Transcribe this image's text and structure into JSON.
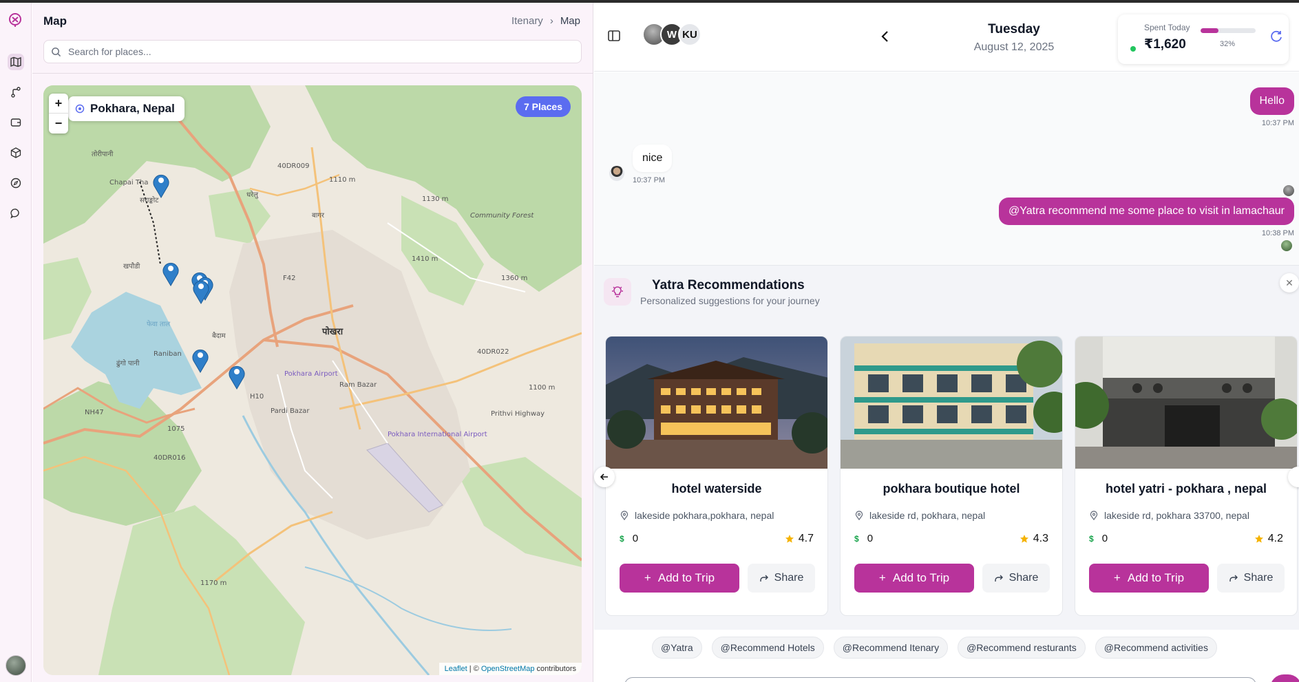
{
  "map_panel": {
    "title": "Map",
    "breadcrumb": [
      "Itenary",
      "Map"
    ],
    "search_placeholder": "Search for places...",
    "location_label": "Pokhara, Nepal",
    "places_badge": "7 Places",
    "zoom_in": "+",
    "zoom_out": "−",
    "attribution": {
      "leaflet": "Leaflet",
      "sep": " | © ",
      "osm": "OpenStreetMap",
      "suffix": " contributors"
    },
    "map_labels": [
      "तोरीपानी",
      "Chapai Tha",
      "सराङ्कोट",
      "खपौडी",
      "फेवा ताल",
      "Raniban",
      "ढुंगो पानी",
      "बैदाम",
      "पोखरा",
      "40DR009",
      "40DR022",
      "40DR016",
      "NH47",
      "H10",
      "F42",
      "बागर",
      "धरेलु",
      "Community Forest",
      "Pokhara Airport",
      "Pokhara International Airport",
      "Ram Bazar",
      "Pardi Bazar",
      "Prithvi Highway",
      "1410 m",
      "1360 m",
      "1130 m",
      "1110 m",
      "1100 m",
      "1075",
      "1170 m"
    ]
  },
  "rail": {
    "icons": [
      "logo-icon",
      "map-icon",
      "route-icon",
      "wallet-icon",
      "package-icon",
      "compass-icon",
      "chat-icon"
    ]
  },
  "header": {
    "members": [
      "W",
      "KU"
    ],
    "day": "Tuesday",
    "date": "August 12, 2025",
    "spent_label": "Spent Today",
    "spent_amount": "₹1,620",
    "spent_percent_label": "32%",
    "spent_fraction": 0.32
  },
  "messages": [
    {
      "side": "out",
      "text": "Hello",
      "time": "10:37 PM"
    },
    {
      "side": "in",
      "text": "nice",
      "time": "10:37 PM"
    },
    {
      "side": "out",
      "text": "@Yatra recommend me some place to visit in lamachaur",
      "time": "10:38 PM"
    }
  ],
  "recommendations": {
    "title": "Yatra Recommendations",
    "subtitle": "Personalized suggestions for your journey",
    "cards": [
      {
        "name": "hotel waterside",
        "address": "lakeside pokhara,pokhara, nepal",
        "price": "0",
        "rating": "4.7",
        "add_label": "Add to Trip",
        "share_label": "Share"
      },
      {
        "name": "pokhara boutique hotel",
        "address": "lakeside rd, pokhara, nepal",
        "price": "0",
        "rating": "4.3",
        "add_label": "Add to Trip",
        "share_label": "Share"
      },
      {
        "name": "hotel yatri - pokhara , nepal",
        "address": "lakeside rd, pokhara 33700, nepal",
        "price": "0",
        "rating": "4.2",
        "add_label": "Add to Trip",
        "share_label": "Share"
      }
    ]
  },
  "quick_chips": [
    "@Yatra",
    "@Recommend Hotels",
    "@Recommend Itenary",
    "@Recommend resturants",
    "@Recommend activities"
  ],
  "colors": {
    "accent": "#b8339b",
    "badge": "#5b6cf0",
    "pin": "#2f7fc9"
  }
}
